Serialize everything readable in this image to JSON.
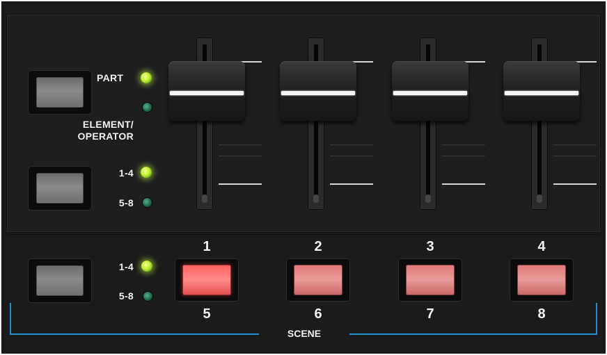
{
  "left_controls": {
    "part_label": "PART",
    "element_operator_label_line1": "ELEMENT/",
    "element_operator_label_line2": "OPERATOR",
    "bank_a_label_top": "1-4",
    "bank_a_label_bottom": "5-8",
    "bank_b_label_top": "1-4",
    "bank_b_label_bottom": "5-8"
  },
  "led_states": {
    "part": "on",
    "element_operator": "off",
    "bank_a_1_4": "on",
    "bank_a_5_8": "off",
    "bank_b_1_4": "on",
    "bank_b_5_8": "off"
  },
  "faders": [
    {
      "id": "fader-1"
    },
    {
      "id": "fader-2"
    },
    {
      "id": "fader-3"
    },
    {
      "id": "fader-4"
    }
  ],
  "scene": {
    "label": "SCENE",
    "buttons": [
      {
        "top": "1",
        "bottom": "5",
        "lit": true
      },
      {
        "top": "2",
        "bottom": "6",
        "lit": false
      },
      {
        "top": "3",
        "bottom": "7",
        "lit": false
      },
      {
        "top": "4",
        "bottom": "8",
        "lit": false
      }
    ]
  },
  "colors": {
    "panel": "#1b1b1c",
    "led_green": "#c9f23b",
    "scene_red": "#ff6b6b",
    "bracket_blue": "#1f8fd0"
  }
}
